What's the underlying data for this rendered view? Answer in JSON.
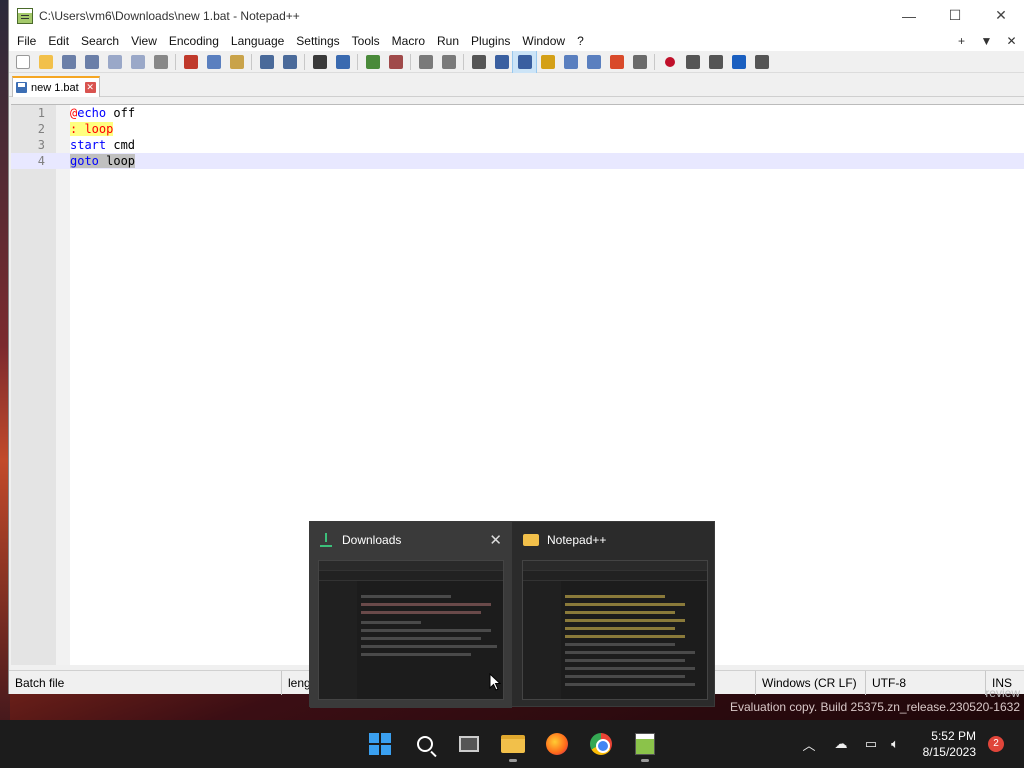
{
  "window": {
    "title": "C:\\Users\\vm6\\Downloads\\new 1.bat - Notepad++",
    "minimize": "—",
    "maximize": "☐",
    "close": "✕"
  },
  "menu": {
    "items": [
      "File",
      "Edit",
      "Search",
      "View",
      "Encoding",
      "Language",
      "Settings",
      "Tools",
      "Macro",
      "Run",
      "Plugins",
      "Window",
      "?"
    ],
    "right": [
      "+",
      "▼",
      "✕"
    ]
  },
  "toolbar": {
    "icons": [
      "new-file-icon",
      "open-file-icon",
      "save-icon",
      "save-all-icon",
      "close-icon",
      "close-all-icon",
      "print-icon",
      "cut-icon",
      "copy-icon",
      "paste-icon",
      "undo-icon",
      "redo-icon",
      "find-icon",
      "replace-icon",
      "zoom-in-icon",
      "zoom-out-icon",
      "sync-vertical-icon",
      "sync-horizontal-icon",
      "word-wrap-icon",
      "show-all-chars-icon",
      "indent-guide-icon",
      "udl-icon",
      "doc-map-icon",
      "function-list-icon",
      "folder-workspace-icon",
      "monitoring-icon",
      "record-macro-icon",
      "stop-record-icon",
      "play-macro-icon",
      "run-macro-multiple-icon",
      "save-macro-icon"
    ],
    "colors": [
      "#ffffff",
      "#f2c04a",
      "#6b7fa8",
      "#6b7fa8",
      "#9aa8c8",
      "#9aa8c8",
      "#888888",
      "#c0392b",
      "#5a7fbf",
      "#c9a34a",
      "#4a6a9a",
      "#4a6a9a",
      "#3a3a3a",
      "#3a6ab0",
      "#4a8a3a",
      "#a04a4a",
      "#7a7a7a",
      "#7a7a7a",
      "#555555",
      "#3a5fa0",
      "#3a5fa0",
      "#d4a017",
      "#5a7fbf",
      "#5a7fbf",
      "#d94a2a",
      "#6a6a6a",
      "#c0102a",
      "#555555",
      "#555555",
      "#1a5fc0",
      "#555555"
    ]
  },
  "tab": {
    "label": "new 1.bat",
    "close": "✕"
  },
  "editor": {
    "lines": [
      {
        "n": "1",
        "tokens": [
          {
            "t": "@",
            "c": "tok-at"
          },
          {
            "t": "echo",
            "c": "tok-kw"
          },
          {
            "t": " off",
            "c": "tok-plain"
          }
        ]
      },
      {
        "n": "2",
        "tokens": [
          {
            "t": ": loop",
            "c": "tok-label"
          }
        ]
      },
      {
        "n": "3",
        "tokens": [
          {
            "t": "start",
            "c": "tok-kw"
          },
          {
            "t": " cmd",
            "c": "tok-plain"
          }
        ]
      },
      {
        "n": "4",
        "tokens": [
          {
            "t": "goto",
            "c": "tok-kw tok-sel"
          },
          {
            "t": " loop",
            "c": "tok-plain tok-sel"
          }
        ]
      }
    ]
  },
  "status": {
    "filetype": "Batch file",
    "length": "length",
    "eol": "Windows (CR LF)",
    "encoding": "UTF-8",
    "mode": "INS"
  },
  "watermark": "Evaluation copy. Build 25375.zn_release.230520-1632",
  "watermark_top": "review",
  "previews": [
    {
      "title": "Downloads",
      "close": "✕"
    },
    {
      "title": "Notepad++"
    }
  ],
  "taskbar": {
    "time": "5:52 PM",
    "date": "8/15/2023",
    "notifications": "2"
  }
}
